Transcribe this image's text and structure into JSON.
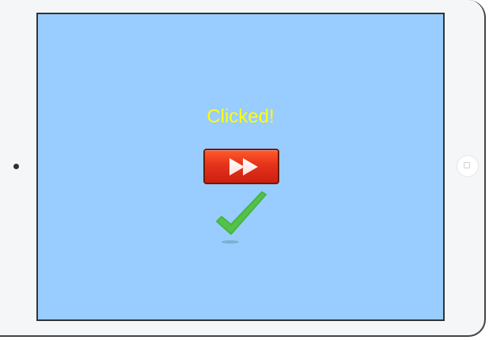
{
  "screen": {
    "status_text": "Clicked!",
    "status_color": "#ffff00",
    "background_color": "#99ccff"
  },
  "controls": {
    "play_button": {
      "icon": "fast-forward-icon",
      "color": "#e5321c"
    }
  },
  "feedback": {
    "icon": "checkmark-icon",
    "color": "#52c24a"
  },
  "device": {
    "left_icon": "camera-dot",
    "right_icon": "home-button-icon"
  }
}
